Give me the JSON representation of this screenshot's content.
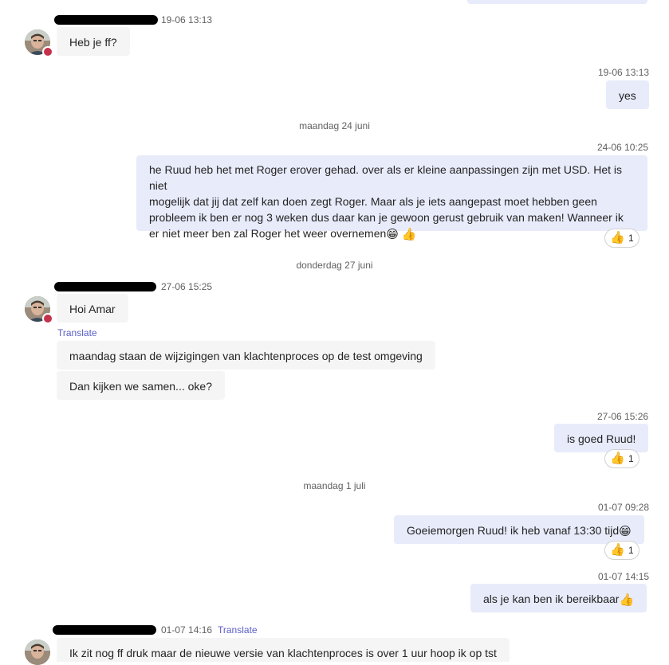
{
  "messages": {
    "m1_time": "19-06 13:13",
    "m1_text": "Heb je ff?",
    "m2_time": "19-06 13:13",
    "m2_text": "yes",
    "day1": "maandag 24 juni",
    "m3_time": "24-06 10:25",
    "m3_line1": "he Ruud heb het met Roger erover gehad. over als er kleine aanpassingen zijn met USD. Het is niet",
    "m3_line2": "mogelijk dat jij dat zelf kan doen zegt Roger. Maar als je iets aangepast moet hebben geen",
    "m3_line3": "probleem ik ben er nog 3 weken dus daar kan je gewoon gerust gebruik van maken! Wanneer ik",
    "m3_line4": "er niet meer ben zal Roger het weer overnemen",
    "m3_react_count": "1",
    "day2": "donderdag 27 juni",
    "m4_time": "27-06 15:25",
    "m4_text": "Hoi Amar",
    "translate1": "Translate",
    "m5_text": "maandag staan de wijzigingen van klachtenproces op de test omgeving",
    "m6_text": "Dan kijken we samen... oke?",
    "m7_time": "27-06 15:26",
    "m7_text": "is goed Ruud!",
    "m7_react_count": "1",
    "day3": "maandag 1 juli",
    "m8_time": "01-07 09:28",
    "m8_text": "Goeiemorgen Ruud! ik heb vanaf 13:30 tijd",
    "m8_react_count": "1",
    "m9_time": "01-07 14:15",
    "m9_text": "als je kan ben ik bereikbaar",
    "m10_time": "01-07 14:16",
    "translate2": "Translate",
    "m10_text": "Ik zit nog ff druk maar de nieuwe versie van klachtenproces is over 1 uur hoop ik op tst"
  },
  "emoji": {
    "grin": "😁",
    "thumbs": "👍"
  },
  "colors": {
    "incoming_bubble": "#f5f5f5",
    "outgoing_bubble": "#e8ebfa",
    "translate_link": "#5b5fc7",
    "status_busy": "#c4314b"
  }
}
